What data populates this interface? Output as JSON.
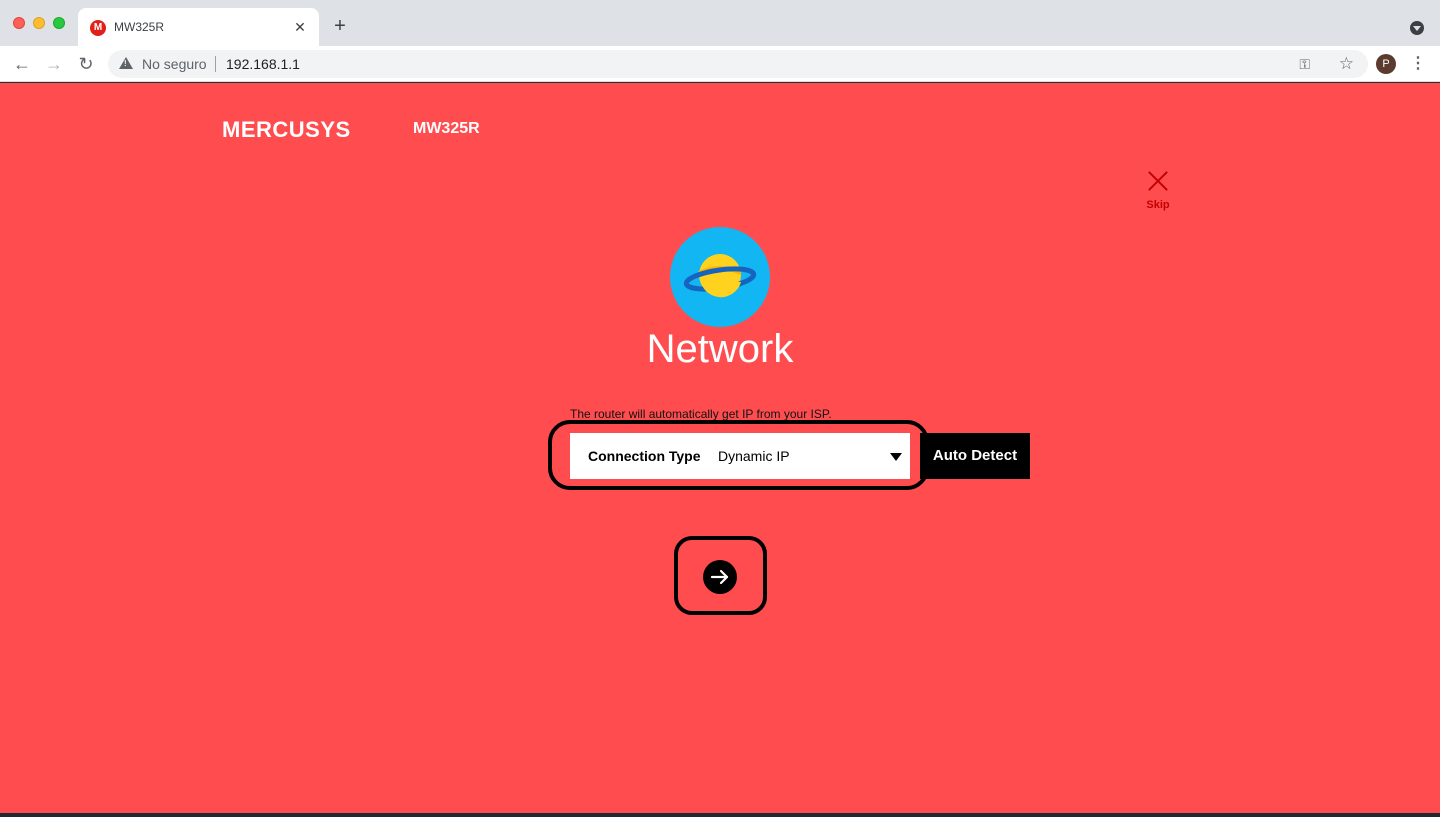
{
  "browser": {
    "tab_title": "MW325R",
    "tab_favicon_letter": "M",
    "security_label": "No seguro",
    "url": "192.168.1.1",
    "profile_initial": "P"
  },
  "header": {
    "brand": "MERCUSYS",
    "model": "MW325R"
  },
  "skip": {
    "label": "Skip"
  },
  "main": {
    "title": "Network",
    "hint": "The router will automatically get IP from your ISP.",
    "connection_type_label": "Connection Type",
    "connection_type_value": "Dynamic IP",
    "auto_detect_label": "Auto Detect"
  },
  "colors": {
    "page_background": "#ff4d4f",
    "skip_color": "#c40000",
    "planet_circle": "#12b6f2",
    "planet_body": "#ffd21f",
    "planet_ring": "#1565c0"
  }
}
